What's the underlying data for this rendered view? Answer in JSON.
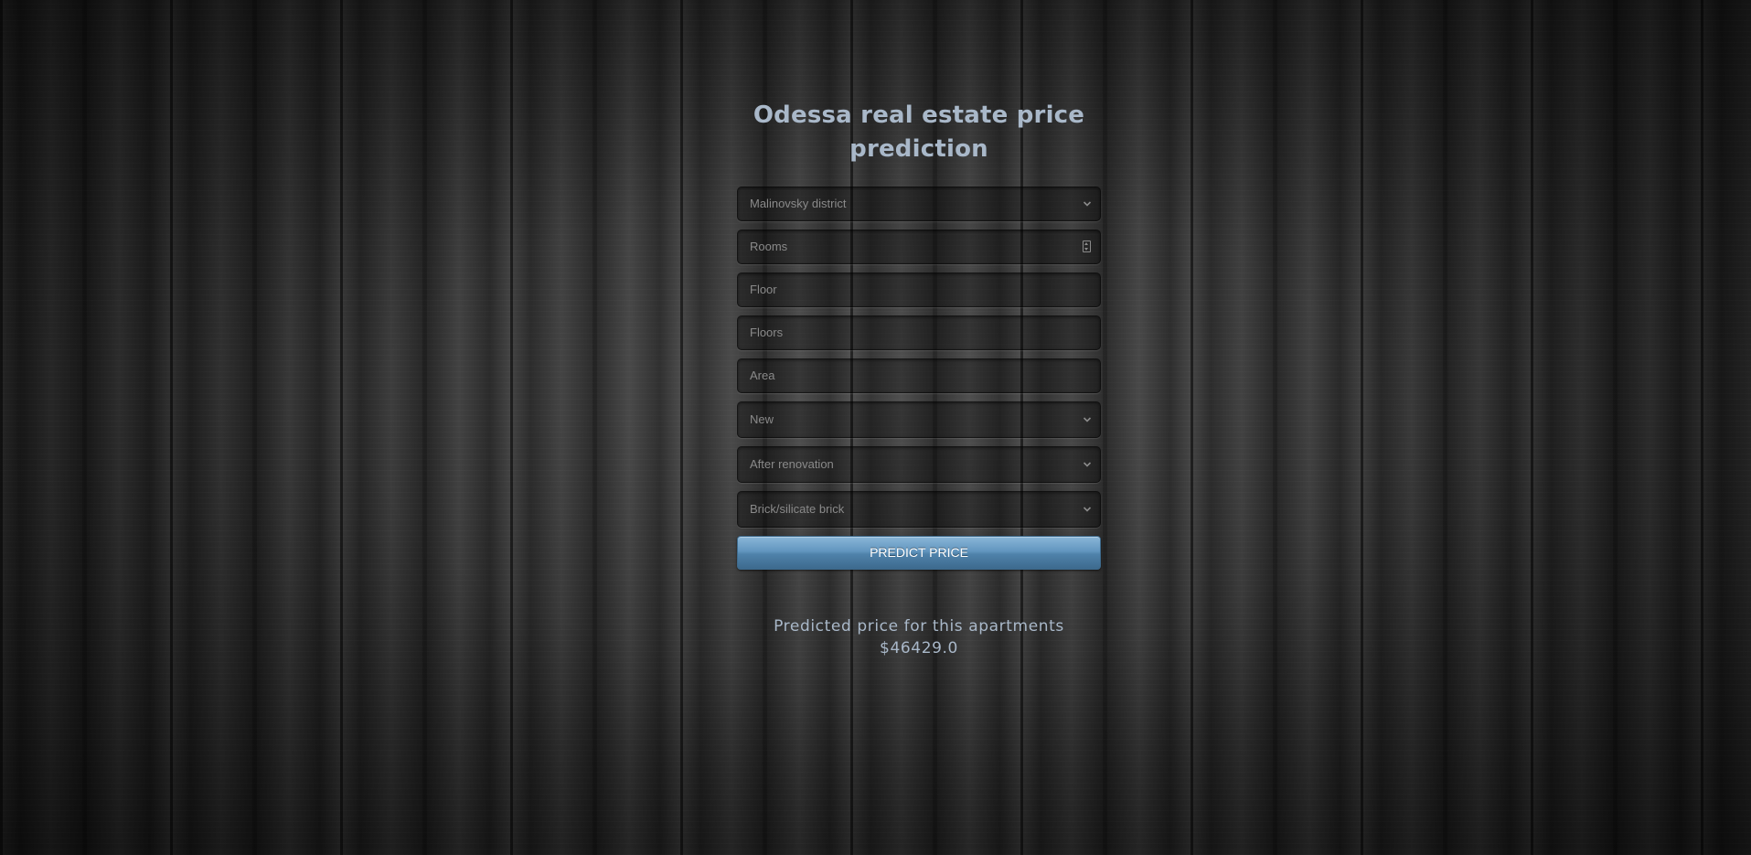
{
  "page": {
    "title": "Odessa real estate price prediction"
  },
  "form": {
    "district": {
      "selected": "Malinovsky district"
    },
    "rooms": {
      "placeholder": "Rooms"
    },
    "floor": {
      "placeholder": "Floor"
    },
    "floors": {
      "placeholder": "Floors"
    },
    "area": {
      "placeholder": "Area"
    },
    "condition": {
      "selected": "New"
    },
    "renovation": {
      "selected": "After renovation"
    },
    "wall_material": {
      "selected": "Brick/silicate brick"
    },
    "submit_label": "PREDICT PRICE"
  },
  "result": {
    "label": "Predicted price for this apartments",
    "value": "$46429.0"
  },
  "colors": {
    "accent": "#5b8fb9",
    "title": "#a9b8c9"
  }
}
